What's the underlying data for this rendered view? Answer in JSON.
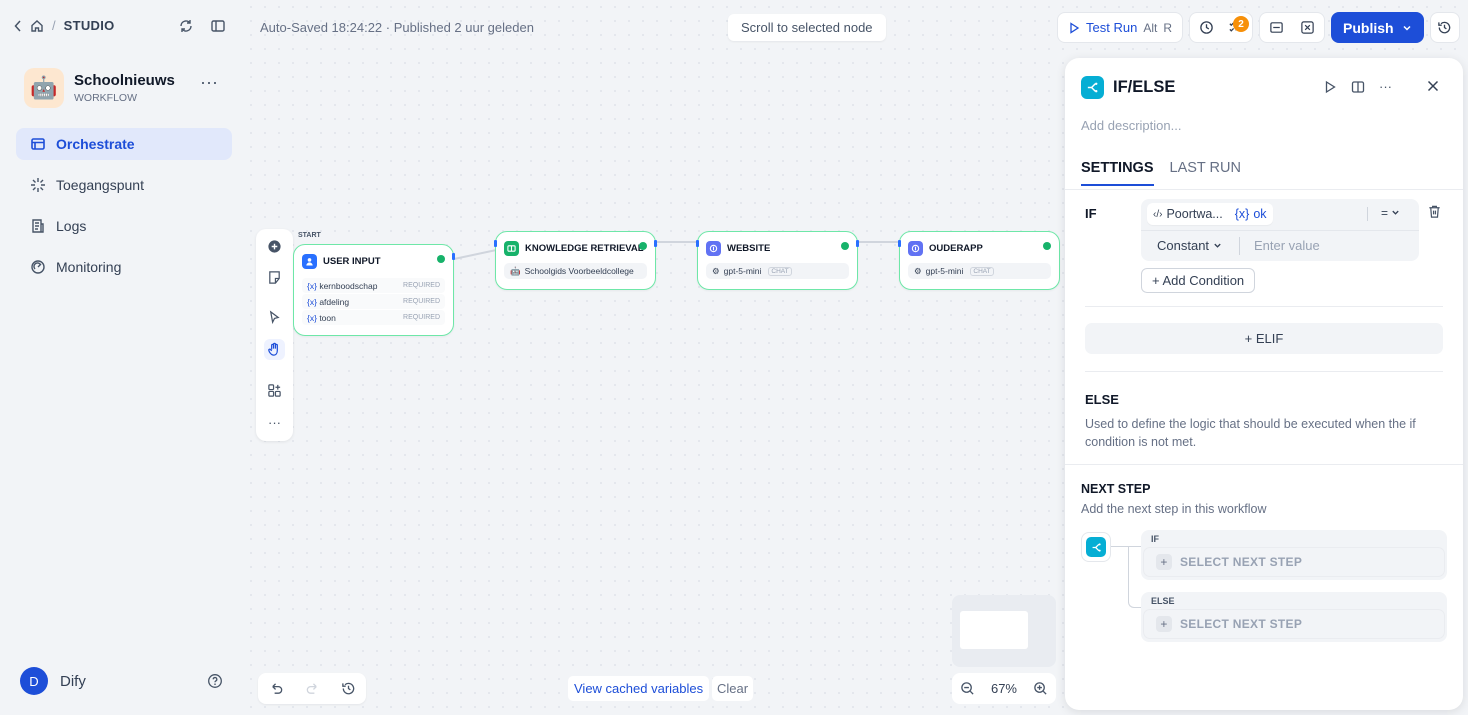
{
  "sidebar": {
    "breadcrumb_label": "STUDIO",
    "app": {
      "name": "Schoolnieuws",
      "type": "WORKFLOW"
    },
    "nav": [
      {
        "label": "Orchestrate",
        "icon": "orchestrate-icon",
        "active": true
      },
      {
        "label": "Toegangspunt",
        "icon": "access-point-icon",
        "active": false
      },
      {
        "label": "Logs",
        "icon": "logs-icon",
        "active": false
      },
      {
        "label": "Monitoring",
        "icon": "monitoring-icon",
        "active": false
      }
    ],
    "user": {
      "initial": "D",
      "name": "Dify"
    }
  },
  "header": {
    "status": "Auto-Saved 18:24:22 · Published 2 uur geleden",
    "scroll_to_node": "Scroll to selected node",
    "test_run": "Test Run",
    "test_run_shortcut_1": "Alt",
    "test_run_shortcut_2": "R",
    "checklist_count": "2",
    "publish": "Publish"
  },
  "canvas": {
    "start_label": "START",
    "nodes": {
      "user_input": {
        "title": "USER INPUT",
        "vars": [
          {
            "prefix": "{x}",
            "name": "kernboodschap",
            "tag": "REQUIRED"
          },
          {
            "prefix": "{x}",
            "name": "afdeling",
            "tag": "REQUIRED"
          },
          {
            "prefix": "{x}",
            "name": "toon",
            "tag": "REQUIRED"
          }
        ]
      },
      "knowledge": {
        "title": "KNOWLEDGE RETRIEVAL",
        "dataset": "Schoolgids Voorbeeldcollege"
      },
      "website": {
        "title": "WEBSITE",
        "model": "gpt-5-mini",
        "mode": "CHAT"
      },
      "ouderapp": {
        "title": "OUDERAPP",
        "model": "gpt-5-mini",
        "mode": "CHAT"
      }
    },
    "view_cached": "View cached variables",
    "clear": "Clear",
    "zoom": "67%"
  },
  "panel": {
    "title": "IF/ELSE",
    "description_placeholder": "Add description...",
    "tabs": {
      "settings": "SETTINGS",
      "last_run": "LAST RUN"
    },
    "if_label": "IF",
    "condition": {
      "variable": "Poortwa...",
      "var_prefix": "{x}",
      "var_value": "ok",
      "operator": "=",
      "value_type": "Constant",
      "value_placeholder": "Enter value"
    },
    "add_condition": "+ Add Condition",
    "elif": "+ ELIF",
    "else_title": "ELSE",
    "else_desc": "Used to define the logic that should be executed when the if condition is not met.",
    "next_step_title": "NEXT STEP",
    "next_step_desc": "Add the next step in this workflow",
    "branches": [
      {
        "label": "IF",
        "action": "SELECT NEXT STEP"
      },
      {
        "label": "ELSE",
        "action": "SELECT NEXT STEP"
      }
    ]
  }
}
